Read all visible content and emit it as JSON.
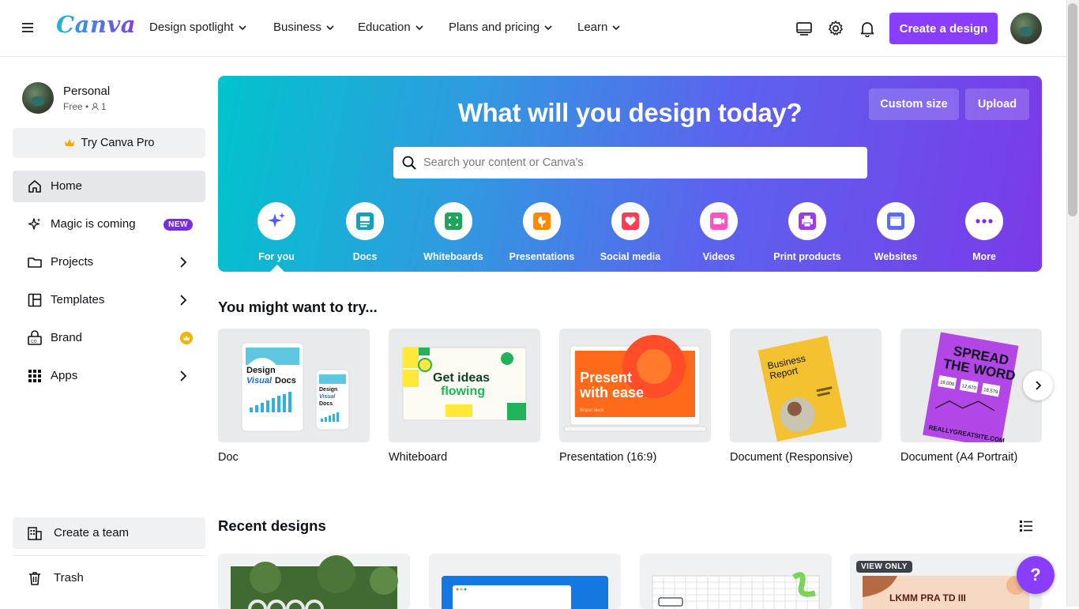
{
  "brand": {
    "logo_text": "Canva",
    "accent": "#8b3dff"
  },
  "nav": {
    "items": [
      {
        "label": "Design spotlight"
      },
      {
        "label": "Business"
      },
      {
        "label": "Education"
      },
      {
        "label": "Plans and pricing"
      },
      {
        "label": "Learn"
      }
    ],
    "create_label": "Create a design"
  },
  "sidebar": {
    "profile": {
      "name": "Personal",
      "plan": "Free",
      "members": "1"
    },
    "try_pro": "Try Canva Pro",
    "items": [
      {
        "label": "Home"
      },
      {
        "label": "Magic is coming",
        "badge": "NEW"
      },
      {
        "label": "Projects"
      },
      {
        "label": "Templates"
      },
      {
        "label": "Brand"
      },
      {
        "label": "Apps"
      }
    ],
    "create_team": "Create a team",
    "trash": "Trash"
  },
  "hero": {
    "title": "What will you design today?",
    "custom_size": "Custom size",
    "upload": "Upload",
    "search_placeholder": "Search your content or Canva's",
    "categories": [
      {
        "label": "For you",
        "icon": "sparkle-icon"
      },
      {
        "label": "Docs",
        "icon": "docs-icon"
      },
      {
        "label": "Whiteboards",
        "icon": "whiteboard-icon"
      },
      {
        "label": "Presentations",
        "icon": "presentation-icon"
      },
      {
        "label": "Social media",
        "icon": "heart-icon"
      },
      {
        "label": "Videos",
        "icon": "video-icon"
      },
      {
        "label": "Print products",
        "icon": "printer-icon"
      },
      {
        "label": "Websites",
        "icon": "website-icon"
      },
      {
        "label": "More",
        "icon": "more-icon"
      }
    ]
  },
  "try_section": {
    "title": "You might want to try...",
    "items": [
      {
        "label": "Doc",
        "thumb_text": [
          "Design",
          "Visual",
          "Docs"
        ]
      },
      {
        "label": "Whiteboard",
        "thumb_text": [
          "Get ideas",
          "flowing"
        ]
      },
      {
        "label": "Presentation (16:9)",
        "thumb_text": [
          "Present",
          "with ease",
          "Brand deck"
        ]
      },
      {
        "label": "Document (Responsive)",
        "thumb_text": [
          "Business",
          "Report"
        ]
      },
      {
        "label": "Document (A4 Portrait)",
        "thumb_text": [
          "SPREAD",
          "THE WORD",
          "REALLYGREATSITE.COM",
          "16,000",
          "12,670",
          "18,579"
        ]
      }
    ]
  },
  "recent": {
    "title": "Recent designs",
    "view_only": "VIEW ONLY",
    "card4_text": "LKMM PRA TD III"
  },
  "help_label": "?"
}
